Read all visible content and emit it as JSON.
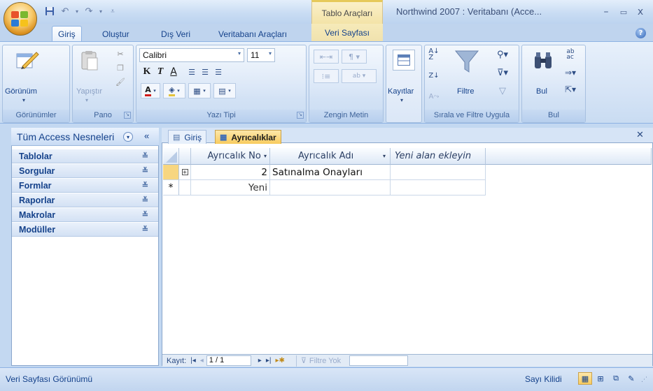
{
  "title_bar": {
    "window_title": "Northwind 2007 : Veritabanı (Acce...",
    "contextual_tab_group": "Tablo Araçları",
    "minimize": "–",
    "maximize": "▭",
    "close": "x"
  },
  "ribbon_tabs": [
    {
      "label": "Giriş",
      "active": true
    },
    {
      "label": "Oluştur"
    },
    {
      "label": "Dış Veri"
    },
    {
      "label": "Veritabanı Araçları"
    },
    {
      "label": "Veri Sayfası",
      "contextual": true
    }
  ],
  "ribbon": {
    "views_group": {
      "label": "Görünümler",
      "view_button": "Görünüm"
    },
    "clipboard_group": {
      "label": "Pano",
      "paste_button": "Yapıştır"
    },
    "font_group": {
      "label": "Yazı Tipi",
      "font_name": "Calibri",
      "font_size": "11",
      "bold": "K",
      "italic": "T",
      "underline": "A"
    },
    "rich_text_group": {
      "label": "Zengin Metin"
    },
    "records_group": {
      "records_button": "Kayıtlar"
    },
    "sort_filter_group": {
      "label": "Sırala ve Filtre Uygula",
      "filter_button": "Filtre"
    },
    "find_group": {
      "label": "Bul",
      "find_button": "Bul"
    }
  },
  "nav_pane": {
    "header": "Tüm Access Nesneleri",
    "groups": [
      "Tablolar",
      "Sorgular",
      "Formlar",
      "Raporlar",
      "Makrolar",
      "Modüller"
    ]
  },
  "doc_tabs": [
    {
      "label": "Giriş"
    },
    {
      "label": "Ayrıcalıklar",
      "active": true
    }
  ],
  "datasheet": {
    "columns": [
      "Ayrıcalık No",
      "Ayrıcalık Adı",
      "Yeni alan ekleyin"
    ],
    "rows": [
      {
        "id": "2",
        "name": "Satınalma Onayları"
      }
    ],
    "new_row_label": "Yeni",
    "new_row_marker": "*"
  },
  "record_nav": {
    "label": "Kayıt:",
    "position": "1 / 1",
    "filter_label": "Filtre Yok",
    "search_value": ""
  },
  "status_bar": {
    "left_text": "Veri Sayfası Görünümü",
    "right_text": "Sayı Kilidi"
  }
}
